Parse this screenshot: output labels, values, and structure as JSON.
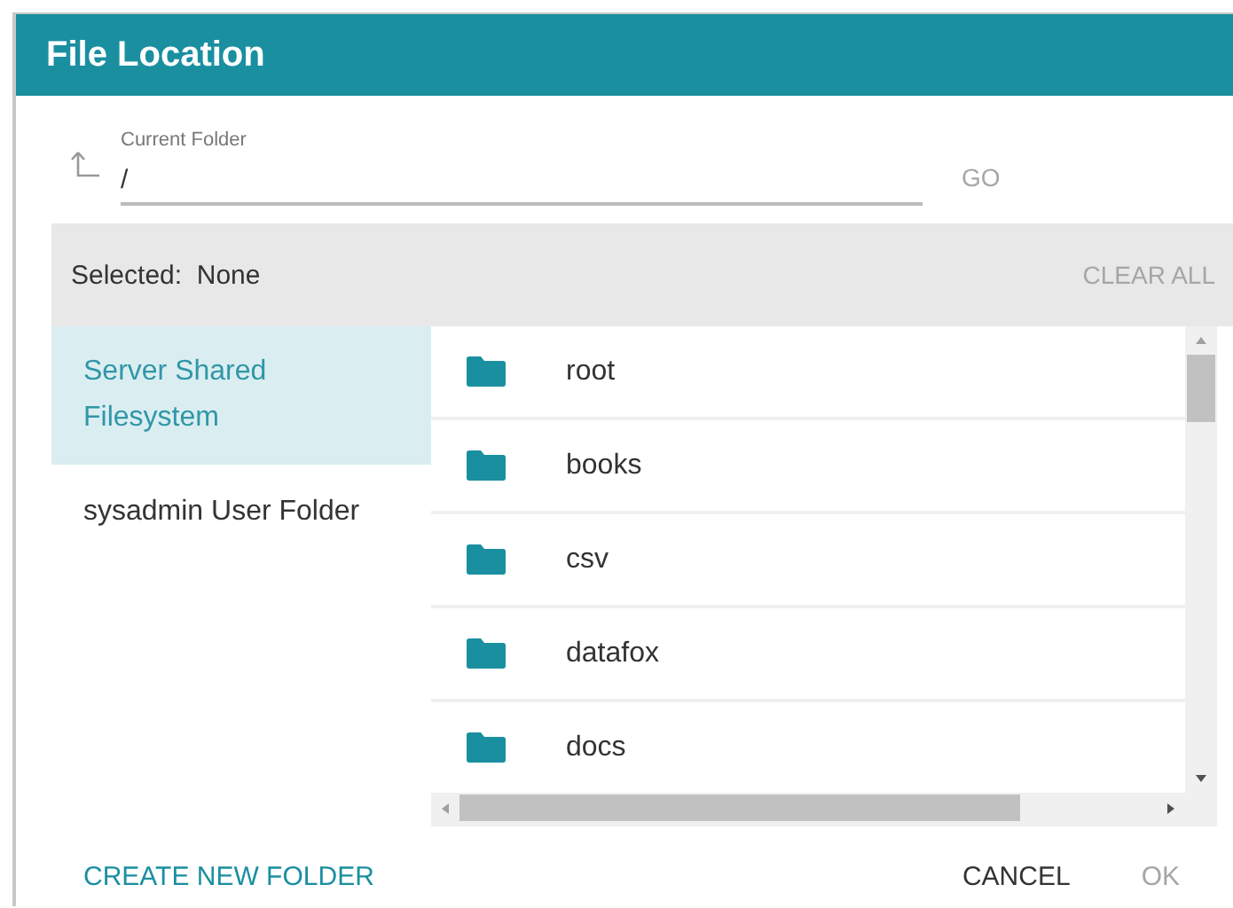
{
  "dialog": {
    "title": "File Location"
  },
  "current_folder": {
    "label": "Current Folder",
    "value": "/"
  },
  "go_button": {
    "label": "GO",
    "disabled": true
  },
  "selection": {
    "text": "Selected:  None",
    "clear_label": "CLEAR ALL",
    "clear_disabled": true
  },
  "sources": [
    {
      "label": "Server Shared Filesystem",
      "selected": true
    },
    {
      "label": "sysadmin User Folder",
      "selected": false
    }
  ],
  "folders": [
    {
      "name": "root"
    },
    {
      "name": "books"
    },
    {
      "name": "csv"
    },
    {
      "name": "datafox"
    },
    {
      "name": "docs"
    }
  ],
  "footer": {
    "create_label": "CREATE NEW FOLDER",
    "cancel_label": "CANCEL",
    "ok_label": "OK",
    "ok_disabled": true
  }
}
